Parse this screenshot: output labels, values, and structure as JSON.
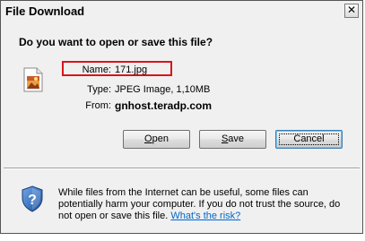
{
  "window": {
    "title": "File Download",
    "close_glyph": "✕"
  },
  "dialog": {
    "question": "Do you want to open or save this file?",
    "file_icon": "jpeg-file-icon",
    "name_label": "Name:",
    "name_value": "171.jpg",
    "type_label": "Type:",
    "type_value": "JPEG Image, 1,10MB",
    "from_label": "From:",
    "from_value": "gnhost.teradp.com",
    "highlight_color": "#d9141a"
  },
  "buttons": {
    "open_prefix": "",
    "open_access": "O",
    "open_rest": "pen",
    "save_prefix": "",
    "save_access": "S",
    "save_rest": "ave",
    "cancel_label": "Cancel"
  },
  "footer": {
    "shield_icon": "security-shield-icon",
    "warning_text": "While files from the Internet can be useful, some files can potentially harm your computer. If you do not trust the source, do not open or save this file. ",
    "risk_link": "What's the risk?"
  },
  "colors": {
    "link": "#0066cc",
    "dialog_bg": "#f0f0f0"
  }
}
